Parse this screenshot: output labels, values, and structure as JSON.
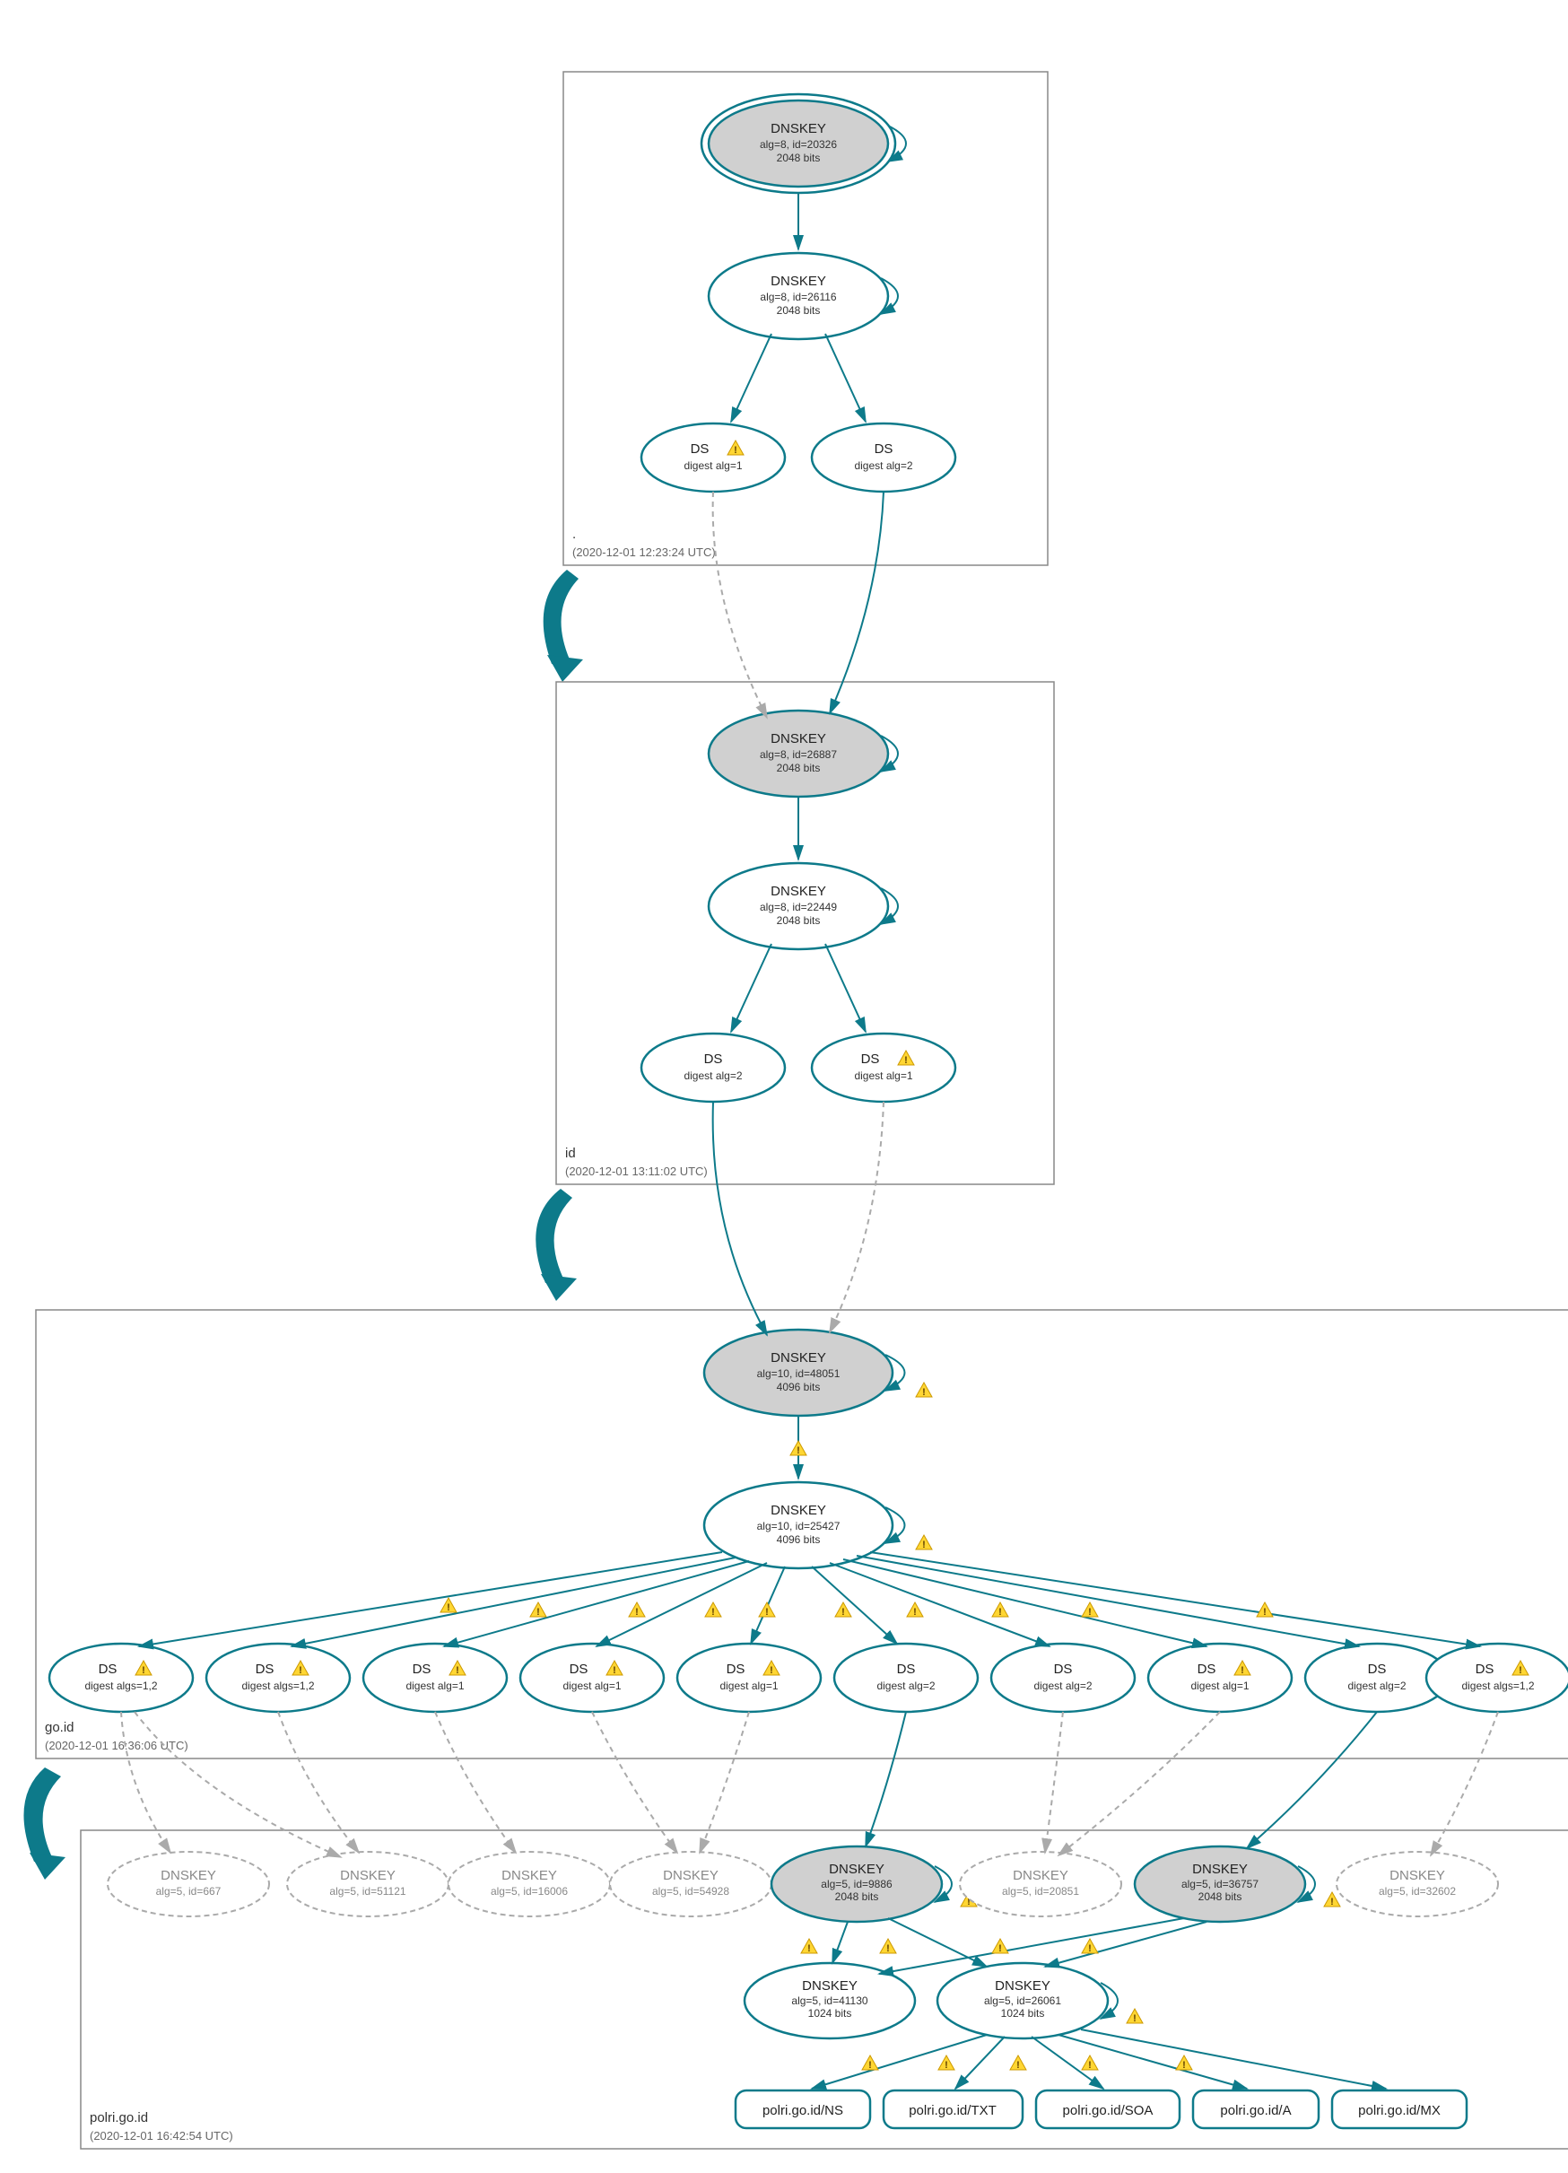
{
  "zones": {
    "root": {
      "label": ".",
      "date": "(2020-12-01 12:23:24 UTC)"
    },
    "id": {
      "label": "id",
      "date": "(2020-12-01 13:11:02 UTC)"
    },
    "goid": {
      "label": "go.id",
      "date": "(2020-12-01 16:36:06 UTC)"
    },
    "polri": {
      "label": "polri.go.id",
      "date": "(2020-12-01 16:42:54 UTC)"
    }
  },
  "nodes": {
    "root_ksk": {
      "t1": "DNSKEY",
      "t2": "alg=8, id=20326",
      "t3": "2048 bits"
    },
    "root_zsk": {
      "t1": "DNSKEY",
      "t2": "alg=8, id=26116",
      "t3": "2048 bits"
    },
    "root_ds1": {
      "t1": "DS",
      "t2": "digest alg=1"
    },
    "root_ds2": {
      "t1": "DS",
      "t2": "digest alg=2"
    },
    "id_ksk": {
      "t1": "DNSKEY",
      "t2": "alg=8, id=26887",
      "t3": "2048 bits"
    },
    "id_zsk": {
      "t1": "DNSKEY",
      "t2": "alg=8, id=22449",
      "t3": "2048 bits"
    },
    "id_ds1": {
      "t1": "DS",
      "t2": "digest alg=2"
    },
    "id_ds2": {
      "t1": "DS",
      "t2": "digest alg=1"
    },
    "goid_ksk": {
      "t1": "DNSKEY",
      "t2": "alg=10, id=48051",
      "t3": "4096 bits"
    },
    "goid_zsk": {
      "t1": "DNSKEY",
      "t2": "alg=10, id=25427",
      "t3": "4096 bits"
    },
    "goid_ds0": {
      "t1": "DS",
      "t2": "digest algs=1,2"
    },
    "goid_ds1": {
      "t1": "DS",
      "t2": "digest algs=1,2"
    },
    "goid_ds2": {
      "t1": "DS",
      "t2": "digest alg=1"
    },
    "goid_ds3": {
      "t1": "DS",
      "t2": "digest alg=1"
    },
    "goid_ds4": {
      "t1": "DS",
      "t2": "digest alg=1"
    },
    "goid_ds5": {
      "t1": "DS",
      "t2": "digest alg=2"
    },
    "goid_ds6": {
      "t1": "DS",
      "t2": "digest alg=2"
    },
    "goid_ds7": {
      "t1": "DS",
      "t2": "digest alg=1"
    },
    "goid_ds8": {
      "t1": "DS",
      "t2": "digest alg=2"
    },
    "goid_ds9": {
      "t1": "DS",
      "t2": "digest algs=1,2"
    },
    "polri_k667": {
      "t1": "DNSKEY",
      "t2": "alg=5, id=667"
    },
    "polri_k51121": {
      "t1": "DNSKEY",
      "t2": "alg=5, id=51121"
    },
    "polri_k16006": {
      "t1": "DNSKEY",
      "t2": "alg=5, id=16006"
    },
    "polri_k54928": {
      "t1": "DNSKEY",
      "t2": "alg=5, id=54928"
    },
    "polri_k9886": {
      "t1": "DNSKEY",
      "t2": "alg=5, id=9886",
      "t3": "2048 bits"
    },
    "polri_k20851": {
      "t1": "DNSKEY",
      "t2": "alg=5, id=20851"
    },
    "polri_k36757": {
      "t1": "DNSKEY",
      "t2": "alg=5, id=36757",
      "t3": "2048 bits"
    },
    "polri_k32602": {
      "t1": "DNSKEY",
      "t2": "alg=5, id=32602"
    },
    "polri_k41130": {
      "t1": "DNSKEY",
      "t2": "alg=5, id=41130",
      "t3": "1024 bits"
    },
    "polri_k26061": {
      "t1": "DNSKEY",
      "t2": "alg=5, id=26061",
      "t3": "1024 bits"
    },
    "rr_ns": {
      "t1": "polri.go.id/NS"
    },
    "rr_txt": {
      "t1": "polri.go.id/TXT"
    },
    "rr_soa": {
      "t1": "polri.go.id/SOA"
    },
    "rr_a": {
      "t1": "polri.go.id/A"
    },
    "rr_mx": {
      "t1": "polri.go.id/MX"
    }
  }
}
